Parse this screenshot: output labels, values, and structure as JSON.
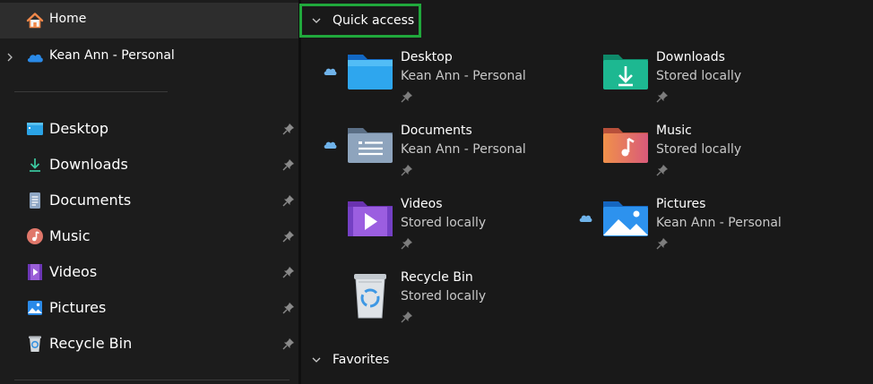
{
  "sidebar": {
    "home": {
      "label": "Home",
      "icon": "home-icon"
    },
    "onedrive": {
      "label": "Kean Ann - Personal",
      "icon": "onedrive-cloud-icon"
    },
    "pinned": [
      {
        "label": "Desktop",
        "icon": "desktop-folder-icon"
      },
      {
        "label": "Downloads",
        "icon": "download-arrow-icon"
      },
      {
        "label": "Documents",
        "icon": "documents-icon"
      },
      {
        "label": "Music",
        "icon": "music-icon"
      },
      {
        "label": "Videos",
        "icon": "videos-icon"
      },
      {
        "label": "Pictures",
        "icon": "pictures-icon"
      },
      {
        "label": "Recycle Bin",
        "icon": "recycle-bin-icon"
      }
    ]
  },
  "main": {
    "quick_access": {
      "label": "Quick access",
      "items": [
        {
          "title": "Desktop",
          "subtitle": "Kean Ann - Personal",
          "cloud": true
        },
        {
          "title": "Downloads",
          "subtitle": "Stored locally",
          "cloud": false
        },
        {
          "title": "Documents",
          "subtitle": "Kean Ann - Personal",
          "cloud": true
        },
        {
          "title": "Music",
          "subtitle": "Stored locally",
          "cloud": false
        },
        {
          "title": "Videos",
          "subtitle": "Stored locally",
          "cloud": false
        },
        {
          "title": "Pictures",
          "subtitle": "Kean Ann - Personal",
          "cloud": true
        },
        {
          "title": "Recycle Bin",
          "subtitle": "Stored locally",
          "cloud": false
        }
      ]
    },
    "favorites": {
      "label": "Favorites"
    }
  },
  "colors": {
    "highlight_border": "#20a83c",
    "selected_row": "#2d2d2d",
    "background": "#191919"
  }
}
